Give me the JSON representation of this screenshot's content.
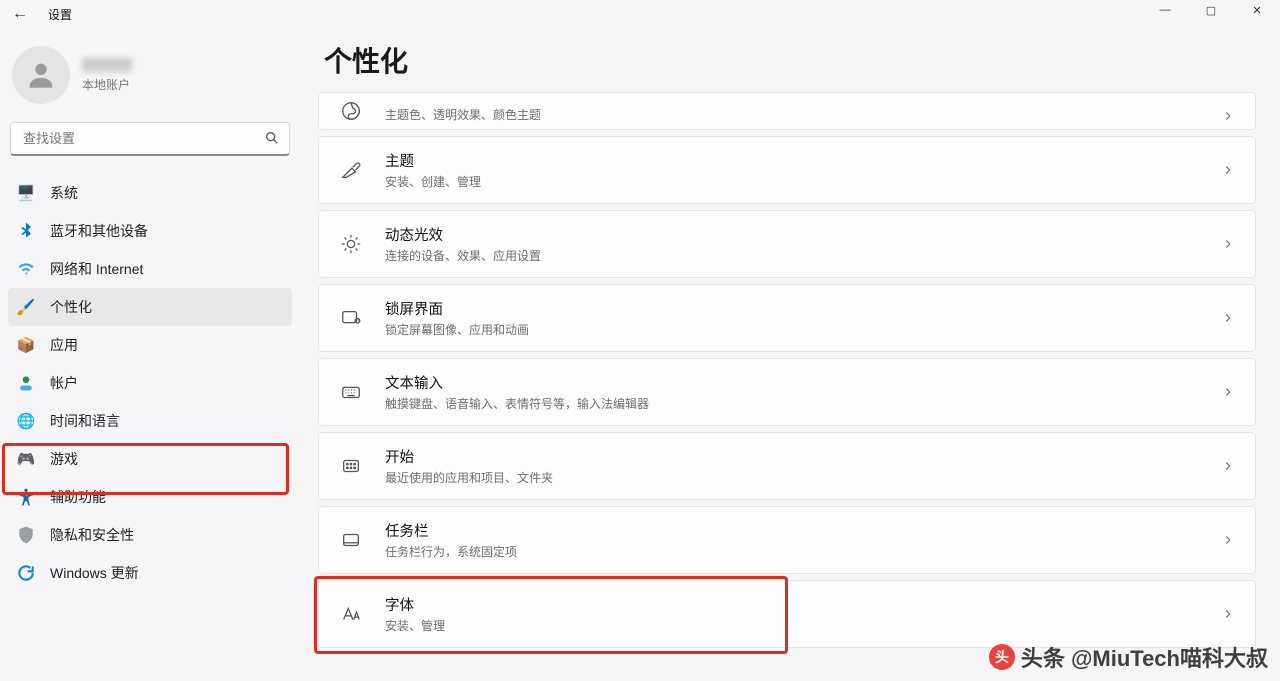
{
  "app": {
    "title": "设置"
  },
  "user": {
    "name": "",
    "type": "本地账户"
  },
  "search": {
    "placeholder": "查找设置"
  },
  "nav": {
    "items": [
      {
        "label": "系统"
      },
      {
        "label": "蓝牙和其他设备"
      },
      {
        "label": "网络和 Internet"
      },
      {
        "label": "个性化"
      },
      {
        "label": "应用"
      },
      {
        "label": "帐户"
      },
      {
        "label": "时间和语言"
      },
      {
        "label": "游戏"
      },
      {
        "label": "辅助功能"
      },
      {
        "label": "隐私和安全性"
      },
      {
        "label": "Windows 更新"
      }
    ]
  },
  "page": {
    "title": "个性化"
  },
  "cards": [
    {
      "title": "",
      "sub": "主题色、透明效果、颜色主题"
    },
    {
      "title": "主题",
      "sub": "安装、创建、管理"
    },
    {
      "title": "动态光效",
      "sub": "连接的设备、效果、应用设置"
    },
    {
      "title": "锁屏界面",
      "sub": "锁定屏幕图像、应用和动画"
    },
    {
      "title": "文本输入",
      "sub": "触摸键盘、语音输入、表情符号等，输入法编辑器"
    },
    {
      "title": "开始",
      "sub": "最近使用的应用和项目、文件夹"
    },
    {
      "title": "任务栏",
      "sub": "任务栏行为，系统固定项"
    },
    {
      "title": "字体",
      "sub": "安装、管理"
    }
  ],
  "watermark": "头条 @MiuTech喵科大叔"
}
